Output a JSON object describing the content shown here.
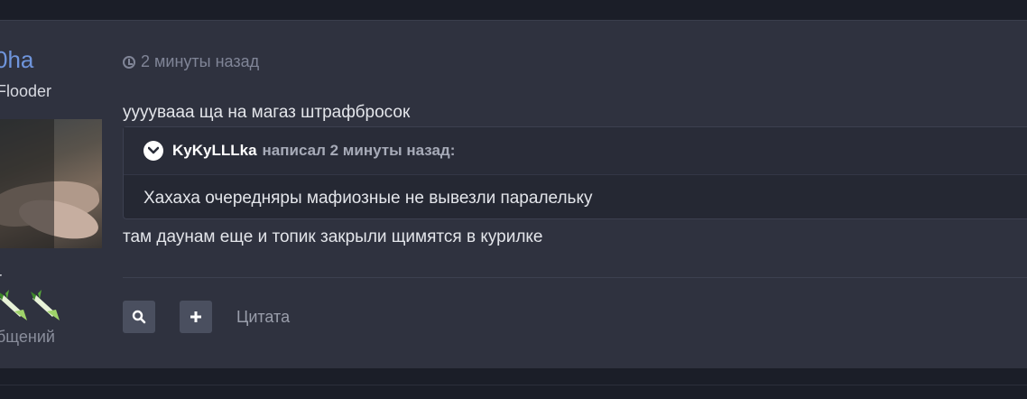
{
  "author": {
    "name": "0ha",
    "rank": "Flooder",
    "extra": "r",
    "posts_label": "бщений"
  },
  "post": {
    "time": "2 минуты назад",
    "line1": "уууувааа ща на магаз штрафбросок",
    "line2": "там даунам еще и топик закрыли щимятся в курилке"
  },
  "quote": {
    "author": "KyKyLLLka",
    "wrote": "написал 2 минуты назад:",
    "text": "Хахаха очередняры мафиозные не вывезли паралельку"
  },
  "actions": {
    "quote_label": "Цитата"
  },
  "icons": [
    "clock-icon",
    "chevron-down-icon",
    "search-icon",
    "plus-icon",
    "leek-badge-icon"
  ],
  "colors": {
    "page_bg": "#1b1e28",
    "post_bg": "#2f323f",
    "author_link": "#6f95dc",
    "button_bg": "#4a4f5f"
  }
}
